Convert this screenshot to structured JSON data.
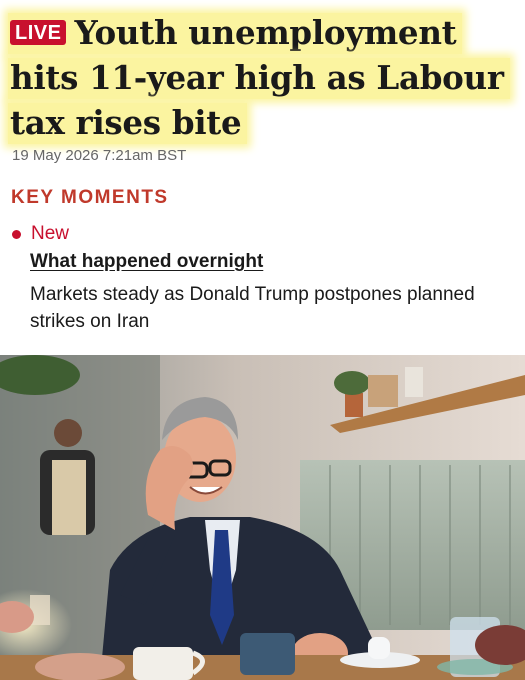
{
  "article": {
    "live_label": "LIVE",
    "headline": "Youth unemployment hits 11-year high as Labour tax rises bite",
    "timestamp": "19 May 2026 7:21am BST"
  },
  "key_moments": {
    "heading": "KEY MOMENTS",
    "items": [
      {
        "badge": "New",
        "title": "What happened overnight",
        "summary": "Markets steady as Donald Trump postpones planned strikes on Iran"
      }
    ]
  },
  "colors": {
    "accent": "#c8102e",
    "highlight": "#fbf4a0"
  }
}
